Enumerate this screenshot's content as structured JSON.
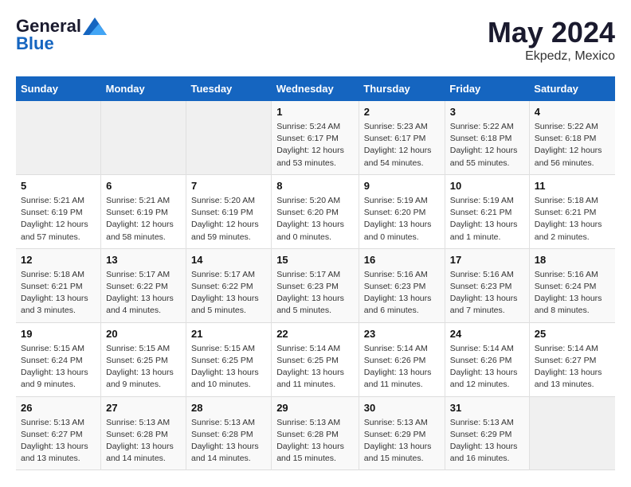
{
  "header": {
    "logo_general": "General",
    "logo_blue": "Blue",
    "month": "May 2024",
    "location": "Ekpedz, Mexico"
  },
  "weekdays": [
    "Sunday",
    "Monday",
    "Tuesday",
    "Wednesday",
    "Thursday",
    "Friday",
    "Saturday"
  ],
  "weeks": [
    [
      {
        "day": "",
        "info": ""
      },
      {
        "day": "",
        "info": ""
      },
      {
        "day": "",
        "info": ""
      },
      {
        "day": "1",
        "info": "Sunrise: 5:24 AM\nSunset: 6:17 PM\nDaylight: 12 hours\nand 53 minutes."
      },
      {
        "day": "2",
        "info": "Sunrise: 5:23 AM\nSunset: 6:17 PM\nDaylight: 12 hours\nand 54 minutes."
      },
      {
        "day": "3",
        "info": "Sunrise: 5:22 AM\nSunset: 6:18 PM\nDaylight: 12 hours\nand 55 minutes."
      },
      {
        "day": "4",
        "info": "Sunrise: 5:22 AM\nSunset: 6:18 PM\nDaylight: 12 hours\nand 56 minutes."
      }
    ],
    [
      {
        "day": "5",
        "info": "Sunrise: 5:21 AM\nSunset: 6:19 PM\nDaylight: 12 hours\nand 57 minutes."
      },
      {
        "day": "6",
        "info": "Sunrise: 5:21 AM\nSunset: 6:19 PM\nDaylight: 12 hours\nand 58 minutes."
      },
      {
        "day": "7",
        "info": "Sunrise: 5:20 AM\nSunset: 6:19 PM\nDaylight: 12 hours\nand 59 minutes."
      },
      {
        "day": "8",
        "info": "Sunrise: 5:20 AM\nSunset: 6:20 PM\nDaylight: 13 hours\nand 0 minutes."
      },
      {
        "day": "9",
        "info": "Sunrise: 5:19 AM\nSunset: 6:20 PM\nDaylight: 13 hours\nand 0 minutes."
      },
      {
        "day": "10",
        "info": "Sunrise: 5:19 AM\nSunset: 6:21 PM\nDaylight: 13 hours\nand 1 minute."
      },
      {
        "day": "11",
        "info": "Sunrise: 5:18 AM\nSunset: 6:21 PM\nDaylight: 13 hours\nand 2 minutes."
      }
    ],
    [
      {
        "day": "12",
        "info": "Sunrise: 5:18 AM\nSunset: 6:21 PM\nDaylight: 13 hours\nand 3 minutes."
      },
      {
        "day": "13",
        "info": "Sunrise: 5:17 AM\nSunset: 6:22 PM\nDaylight: 13 hours\nand 4 minutes."
      },
      {
        "day": "14",
        "info": "Sunrise: 5:17 AM\nSunset: 6:22 PM\nDaylight: 13 hours\nand 5 minutes."
      },
      {
        "day": "15",
        "info": "Sunrise: 5:17 AM\nSunset: 6:23 PM\nDaylight: 13 hours\nand 5 minutes."
      },
      {
        "day": "16",
        "info": "Sunrise: 5:16 AM\nSunset: 6:23 PM\nDaylight: 13 hours\nand 6 minutes."
      },
      {
        "day": "17",
        "info": "Sunrise: 5:16 AM\nSunset: 6:23 PM\nDaylight: 13 hours\nand 7 minutes."
      },
      {
        "day": "18",
        "info": "Sunrise: 5:16 AM\nSunset: 6:24 PM\nDaylight: 13 hours\nand 8 minutes."
      }
    ],
    [
      {
        "day": "19",
        "info": "Sunrise: 5:15 AM\nSunset: 6:24 PM\nDaylight: 13 hours\nand 9 minutes."
      },
      {
        "day": "20",
        "info": "Sunrise: 5:15 AM\nSunset: 6:25 PM\nDaylight: 13 hours\nand 9 minutes."
      },
      {
        "day": "21",
        "info": "Sunrise: 5:15 AM\nSunset: 6:25 PM\nDaylight: 13 hours\nand 10 minutes."
      },
      {
        "day": "22",
        "info": "Sunrise: 5:14 AM\nSunset: 6:25 PM\nDaylight: 13 hours\nand 11 minutes."
      },
      {
        "day": "23",
        "info": "Sunrise: 5:14 AM\nSunset: 6:26 PM\nDaylight: 13 hours\nand 11 minutes."
      },
      {
        "day": "24",
        "info": "Sunrise: 5:14 AM\nSunset: 6:26 PM\nDaylight: 13 hours\nand 12 minutes."
      },
      {
        "day": "25",
        "info": "Sunrise: 5:14 AM\nSunset: 6:27 PM\nDaylight: 13 hours\nand 13 minutes."
      }
    ],
    [
      {
        "day": "26",
        "info": "Sunrise: 5:13 AM\nSunset: 6:27 PM\nDaylight: 13 hours\nand 13 minutes."
      },
      {
        "day": "27",
        "info": "Sunrise: 5:13 AM\nSunset: 6:28 PM\nDaylight: 13 hours\nand 14 minutes."
      },
      {
        "day": "28",
        "info": "Sunrise: 5:13 AM\nSunset: 6:28 PM\nDaylight: 13 hours\nand 14 minutes."
      },
      {
        "day": "29",
        "info": "Sunrise: 5:13 AM\nSunset: 6:28 PM\nDaylight: 13 hours\nand 15 minutes."
      },
      {
        "day": "30",
        "info": "Sunrise: 5:13 AM\nSunset: 6:29 PM\nDaylight: 13 hours\nand 15 minutes."
      },
      {
        "day": "31",
        "info": "Sunrise: 5:13 AM\nSunset: 6:29 PM\nDaylight: 13 hours\nand 16 minutes."
      },
      {
        "day": "",
        "info": ""
      }
    ]
  ]
}
